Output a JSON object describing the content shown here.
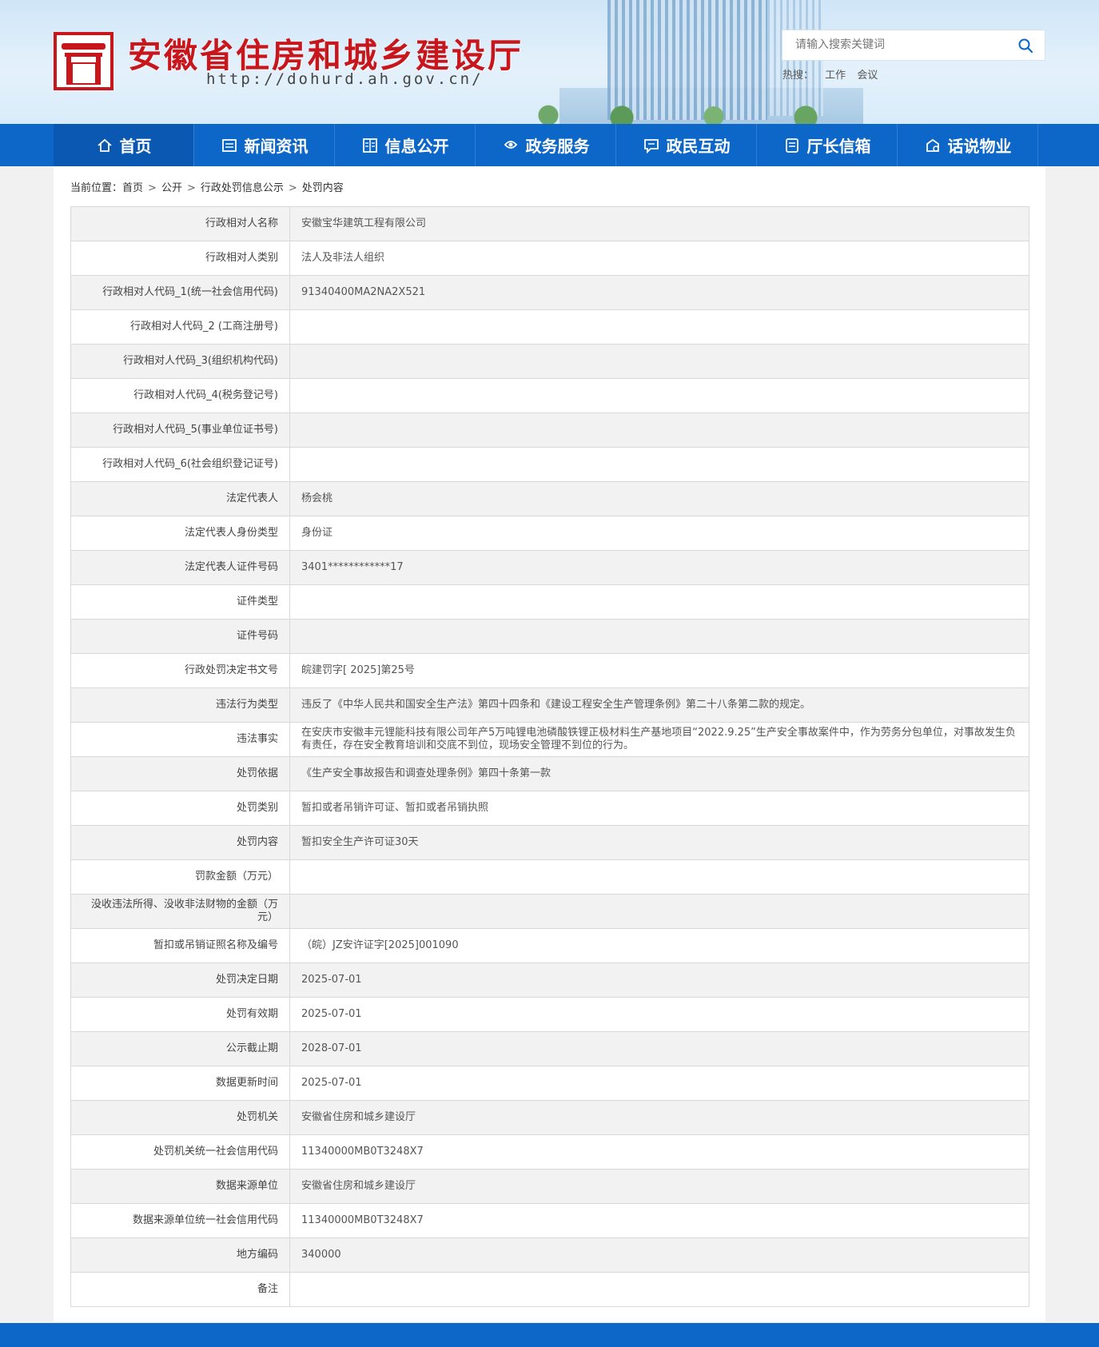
{
  "header": {
    "site_title": "安徽省住房和城乡建设厅",
    "site_url": "http://dohurd.ah.gov.cn/",
    "search_placeholder": "请输入搜索关键词",
    "hot_label": "热搜：",
    "hot_items": [
      "工作",
      "会议"
    ],
    "colors": {
      "brand_red": "#c8161d",
      "nav_blue": "#0d67c9"
    }
  },
  "nav": {
    "items": [
      {
        "label": "首页",
        "icon": "home-icon"
      },
      {
        "label": "新闻资讯",
        "icon": "news-icon"
      },
      {
        "label": "信息公开",
        "icon": "book-icon"
      },
      {
        "label": "政务服务",
        "icon": "service-icon"
      },
      {
        "label": "政民互动",
        "icon": "chat-icon"
      },
      {
        "label": "厅长信箱",
        "icon": "mailbox-icon"
      },
      {
        "label": "话说物业",
        "icon": "property-icon"
      }
    ]
  },
  "breadcrumb": {
    "prefix": "当前位置：",
    "items": [
      "首页",
      "公开",
      "行政处罚信息公示",
      "处罚内容"
    ],
    "separator": ">"
  },
  "table": {
    "rows": [
      {
        "label": "行政相对人名称",
        "value": "安徽宝华建筑工程有限公司"
      },
      {
        "label": "行政相对人类别",
        "value": "法人及非法人组织"
      },
      {
        "label": "行政相对人代码_1(统一社会信用代码)",
        "value": "91340400MA2NA2X521"
      },
      {
        "label": "行政相对人代码_2 (工商注册号)",
        "value": ""
      },
      {
        "label": "行政相对人代码_3(组织机构代码)",
        "value": ""
      },
      {
        "label": "行政相对人代码_4(税务登记号)",
        "value": ""
      },
      {
        "label": "行政相对人代码_5(事业单位证书号)",
        "value": ""
      },
      {
        "label": "行政相对人代码_6(社会组织登记证号)",
        "value": ""
      },
      {
        "label": "法定代表人",
        "value": "杨会桃"
      },
      {
        "label": "法定代表人身份类型",
        "value": "身份证"
      },
      {
        "label": "法定代表人证件号码",
        "value": "3401************17"
      },
      {
        "label": "证件类型",
        "value": ""
      },
      {
        "label": "证件号码",
        "value": ""
      },
      {
        "label": "行政处罚决定书文号",
        "value": "皖建罚字[ 2025]第25号"
      },
      {
        "label": "违法行为类型",
        "value": "违反了《中华人民共和国安全生产法》第四十四条和《建设工程安全生产管理条例》第二十八条第二款的规定。"
      },
      {
        "label": "违法事实",
        "value": "在安庆市安徽丰元锂能科技有限公司年产5万吨锂电池磷酸铁锂正极材料生产基地项目“2022.9.25”生产安全事故案件中，作为劳务分包单位，对事故发生负有责任，存在安全教育培训和交底不到位，现场安全管理不到位的行为。"
      },
      {
        "label": "处罚依据",
        "value": "《生产安全事故报告和调查处理条例》第四十条第一款"
      },
      {
        "label": "处罚类别",
        "value": "暂扣或者吊销许可证、暂扣或者吊销执照"
      },
      {
        "label": "处罚内容",
        "value": "暂扣安全生产许可证30天"
      },
      {
        "label": "罚款金额（万元）",
        "value": ""
      },
      {
        "label": "没收违法所得、没收非法财物的金额（万元）",
        "value": ""
      },
      {
        "label": "暂扣或吊销证照名称及编号",
        "value": "（皖）JZ安许证字[2025]001090"
      },
      {
        "label": "处罚决定日期",
        "value": "2025-07-01"
      },
      {
        "label": "处罚有效期",
        "value": "2025-07-01"
      },
      {
        "label": "公示截止期",
        "value": "2028-07-01"
      },
      {
        "label": "数据更新时间",
        "value": "2025-07-01"
      },
      {
        "label": "处罚机关",
        "value": "安徽省住房和城乡建设厅"
      },
      {
        "label": "处罚机关统一社会信用代码",
        "value": "11340000MB0T3248X7"
      },
      {
        "label": "数据来源单位",
        "value": "安徽省住房和城乡建设厅"
      },
      {
        "label": "数据来源单位统一社会信用代码",
        "value": "11340000MB0T3248X7"
      },
      {
        "label": "地方编码",
        "value": "340000"
      },
      {
        "label": "备注",
        "value": ""
      }
    ]
  }
}
